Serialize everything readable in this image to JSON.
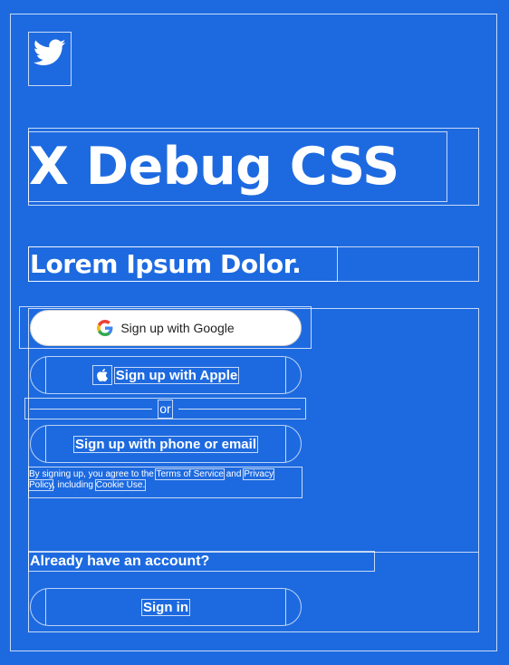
{
  "brand": {
    "logo_icon": "twitter-bird-icon",
    "accent_color": "#1d6ae0"
  },
  "hero": {
    "title": "X Debug CSS",
    "subtitle": "Lorem Ipsum Dolor."
  },
  "auth": {
    "google_label": "Sign up with Google",
    "apple_label": "Sign up with Apple",
    "divider_label": "or",
    "phone_label": "Sign up with phone or email",
    "legal": {
      "prefix": "By signing up, you agree to the ",
      "terms_link": "Terms of Service",
      "and_text": " and ",
      "privacy_link": "Privacy Policy",
      "including_text": ", including ",
      "cookie_link": "Cookie Use."
    },
    "have_account": "Already have an account?",
    "signin_label": "Sign in"
  }
}
